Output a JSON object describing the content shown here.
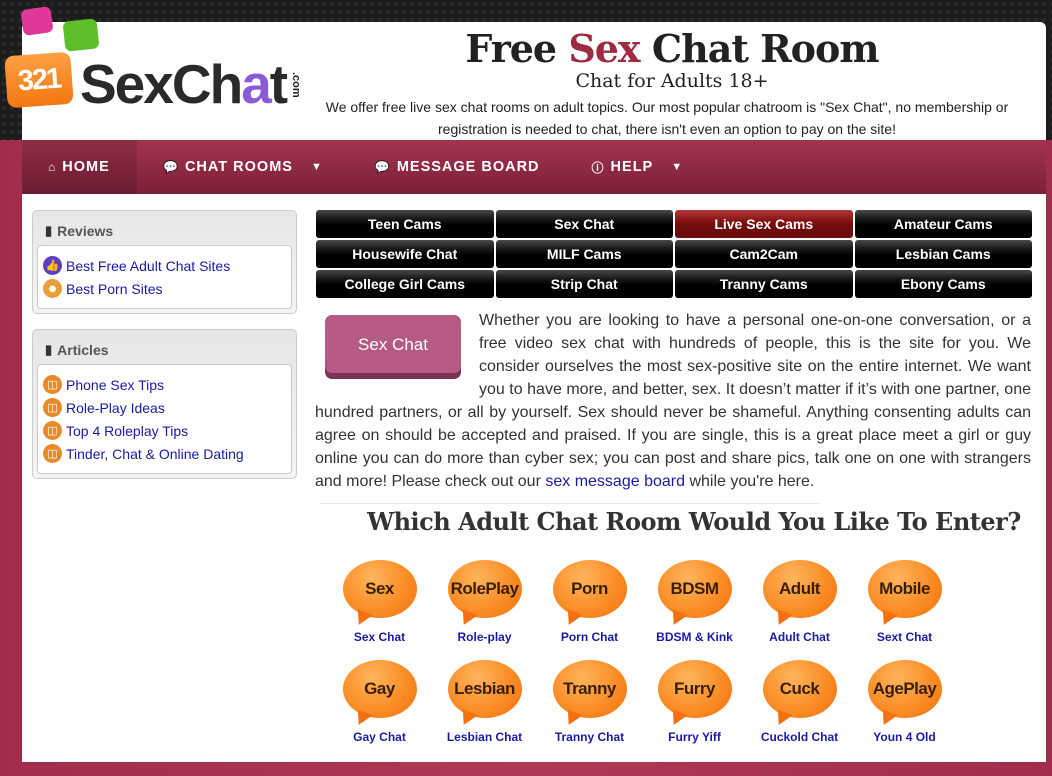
{
  "header": {
    "logo": {
      "badge": "321",
      "text_before": "SexCh",
      "text_accent": "a",
      "text_after": "t",
      "tld": ".com"
    },
    "title_before": "Free ",
    "title_highlight": "Sex",
    "title_after": " Chat Room",
    "subtitle": "Chat for Adults 18+",
    "description": "We offer free live sex chat rooms on adult topics. Our most popular chatroom is \"Sex Chat\", no membership or registration is needed to chat, there isn't even an option to pay on the site!",
    "accent_color": "#9e2b44"
  },
  "nav": {
    "items": [
      {
        "label": "HOME",
        "icon": "home-icon",
        "dropdown": false
      },
      {
        "label": "CHAT ROOMS",
        "icon": "chat-bubbles-icon",
        "dropdown": true
      },
      {
        "label": "MESSAGE BOARD",
        "icon": "chat-bubbles-icon",
        "dropdown": false
      },
      {
        "label": "HELP",
        "icon": "info-icon",
        "dropdown": true
      }
    ]
  },
  "sidebar": {
    "reviews": {
      "title": "Reviews",
      "items": [
        {
          "label": "Best Free Adult Chat Sites",
          "icon": "thumbs-up-icon"
        },
        {
          "label": "Best Porn Sites",
          "icon": "nerd-face-icon"
        }
      ]
    },
    "articles": {
      "title": "Articles",
      "items": [
        {
          "label": "Phone Sex Tips",
          "icon": "book-icon"
        },
        {
          "label": "Role-Play Ideas",
          "icon": "book-icon"
        },
        {
          "label": "Top 4 Roleplay Tips",
          "icon": "book-icon"
        },
        {
          "label": "Tinder, Chat & Online Dating",
          "icon": "book-icon"
        }
      ]
    }
  },
  "cam_links": [
    {
      "label": "Teen Cams",
      "active": false
    },
    {
      "label": "Sex Chat",
      "active": false
    },
    {
      "label": "Live Sex Cams",
      "active": true
    },
    {
      "label": "Amateur Cams",
      "active": false
    },
    {
      "label": "Housewife Chat",
      "active": false
    },
    {
      "label": "MILF Cams",
      "active": false
    },
    {
      "label": "Cam2Cam",
      "active": false
    },
    {
      "label": "Lesbian Cams",
      "active": false
    },
    {
      "label": "College Girl Cams",
      "active": false
    },
    {
      "label": "Strip Chat",
      "active": false
    },
    {
      "label": "Tranny Cams",
      "active": false
    },
    {
      "label": "Ebony Cams",
      "active": false
    }
  ],
  "intro": {
    "button_label": "Sex Chat",
    "text_before_link": "Whether you are looking to have a personal one-on-one conversation, or a free video sex chat with hundreds of people, this is the site for you. We consider ourselves the most sex-positive site on the entire internet. We want you to have more, and better, sex. It doesn’t matter if it’s with one partner, one hundred partners, or all by yourself. Sex should never be shameful. Anything consenting adults can agree on should be accepted and praised. If you are single, this is a great place meet a girl or guy online you can do more than cyber sex; you can post and share pics, talk one on one with strangers and more! Please check out our ",
    "link_text": "sex message board",
    "text_after_link": " while you're here."
  },
  "rooms_heading": "Which Adult Chat Room Would You Like To Enter?",
  "rooms": [
    {
      "bubble": "Sex",
      "label": "Sex Chat"
    },
    {
      "bubble": "RolePlay",
      "label": "Role-play"
    },
    {
      "bubble": "Porn",
      "label": "Porn Chat"
    },
    {
      "bubble": "BDSM",
      "label": "BDSM & Kink"
    },
    {
      "bubble": "Adult",
      "label": "Adult Chat"
    },
    {
      "bubble": "Mobile",
      "label": "Sext Chat"
    },
    {
      "bubble": "Gay",
      "label": "Gay Chat"
    },
    {
      "bubble": "Lesbian",
      "label": "Lesbian Chat"
    },
    {
      "bubble": "Tranny",
      "label": "Tranny Chat"
    },
    {
      "bubble": "Furry",
      "label": "Furry Yiff"
    },
    {
      "bubble": "Cuck",
      "label": "Cuckold Chat"
    },
    {
      "bubble": "AgePlay",
      "label": "Youn 4 Old"
    }
  ]
}
